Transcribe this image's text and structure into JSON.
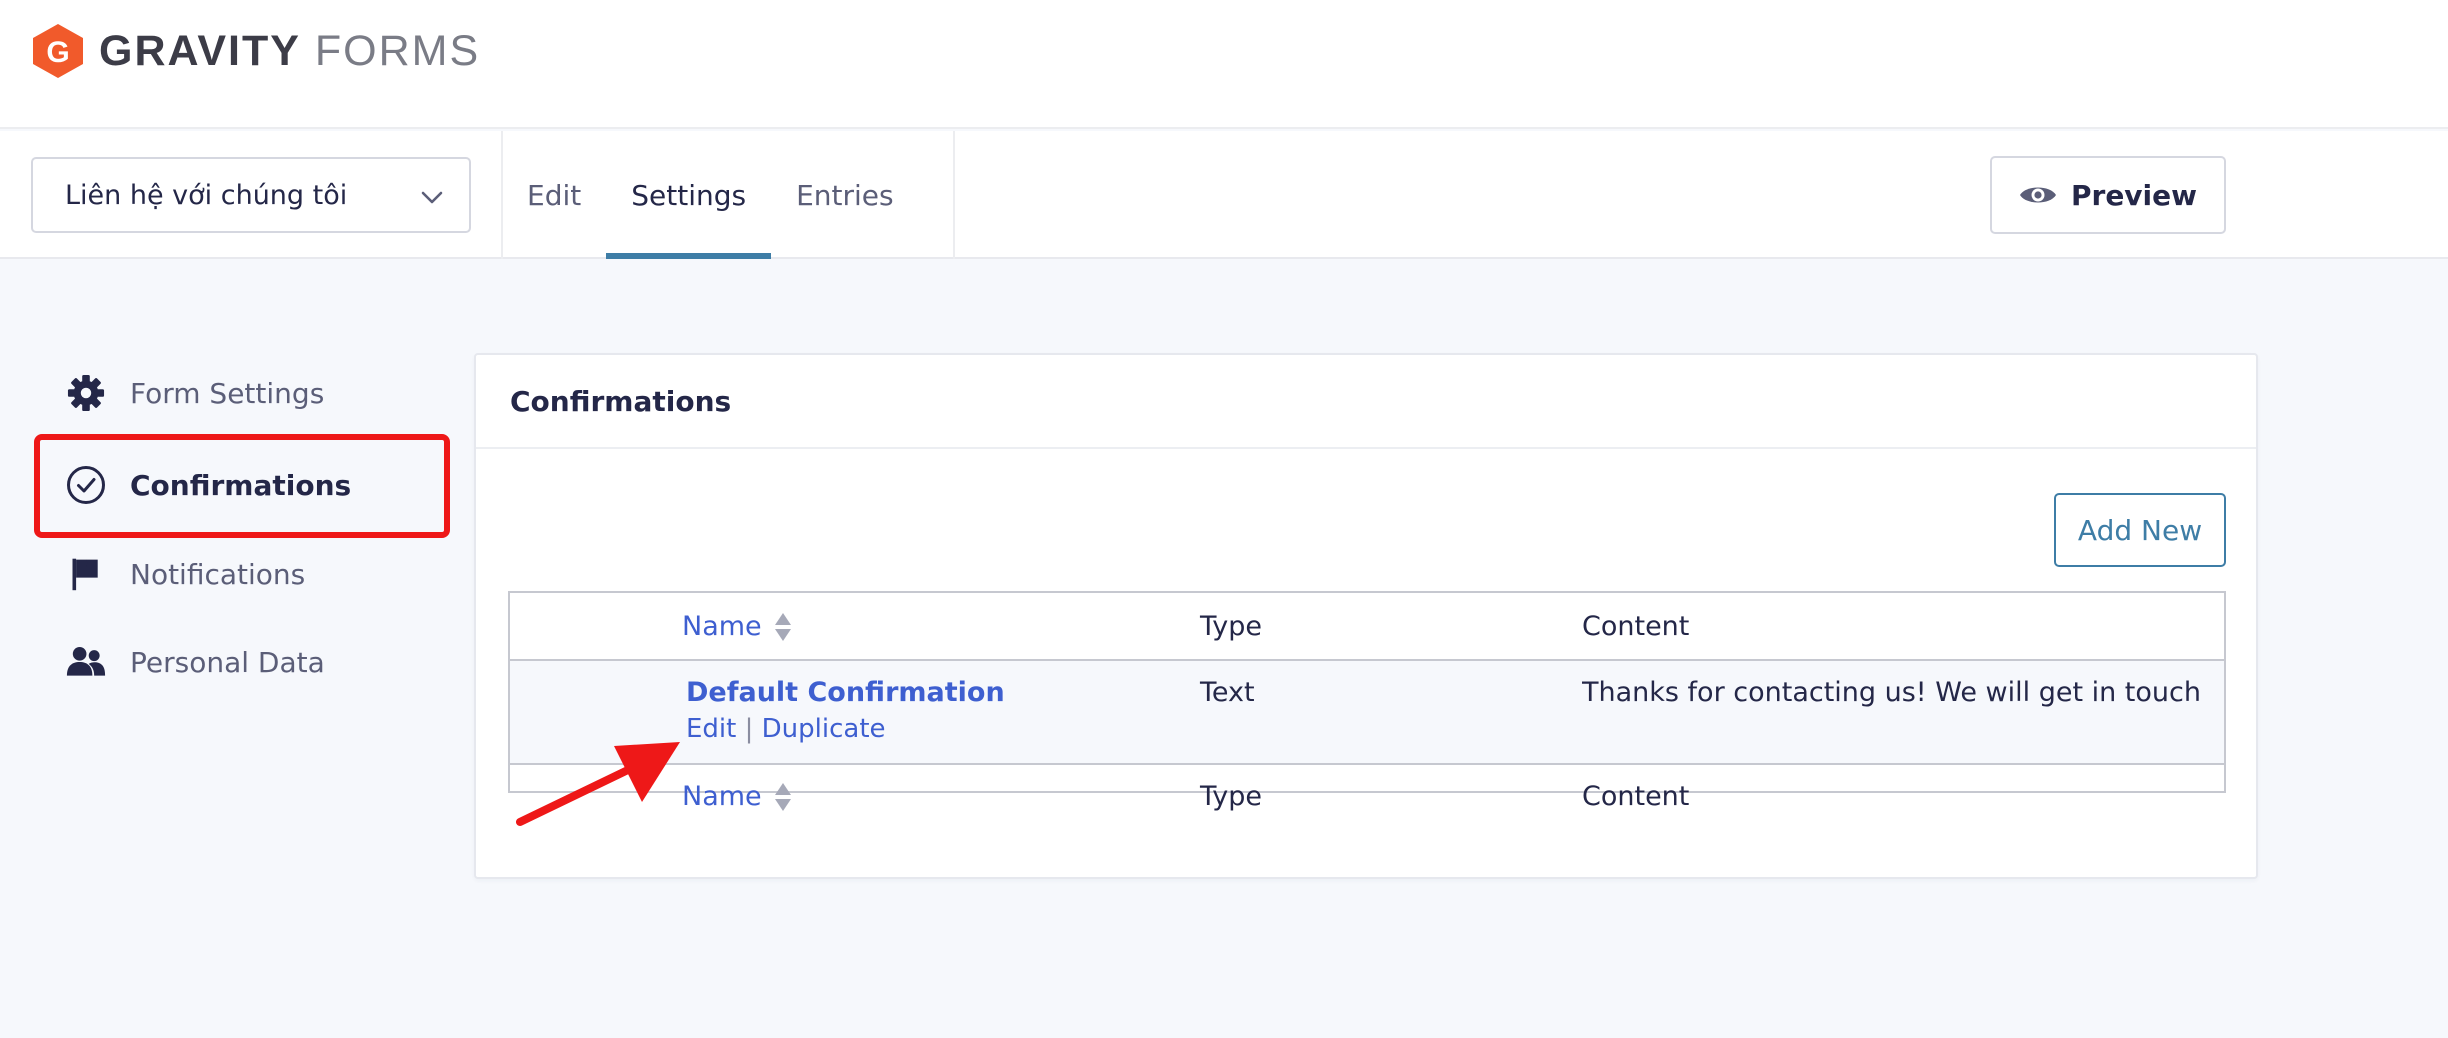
{
  "brand": {
    "name_bold": "GRAVITY",
    "name_light": "FORMS",
    "logo_letter": "G",
    "logo_color": "#f15a2b"
  },
  "toolbar": {
    "form_select_value": "Liên hệ với chúng tôi",
    "tabs": [
      {
        "label": "Edit",
        "active": false
      },
      {
        "label": "Settings",
        "active": true
      },
      {
        "label": "Entries",
        "active": false
      }
    ],
    "preview_label": "Preview"
  },
  "sidebar": {
    "items": [
      {
        "label": "Form Settings",
        "icon": "gear-icon"
      },
      {
        "label": "Confirmations",
        "icon": "check-circle-icon",
        "active": true
      },
      {
        "label": "Notifications",
        "icon": "flag-icon"
      },
      {
        "label": "Personal Data",
        "icon": "users-icon"
      }
    ]
  },
  "panel": {
    "title": "Confirmations",
    "add_new_label": "Add New",
    "table": {
      "columns": [
        "Name",
        "Type",
        "Content"
      ],
      "rows": [
        {
          "name": "Default Confirmation",
          "type": "Text",
          "content": "Thanks for contacting us! We will get in touch wi...",
          "actions": {
            "edit": "Edit",
            "separator": "|",
            "duplicate": "Duplicate"
          }
        }
      ]
    }
  },
  "colors": {
    "accent_blue": "#3e7da6",
    "link_blue": "#3e5fd0",
    "highlight_red": "#ee1818",
    "text_dark": "#242748"
  }
}
